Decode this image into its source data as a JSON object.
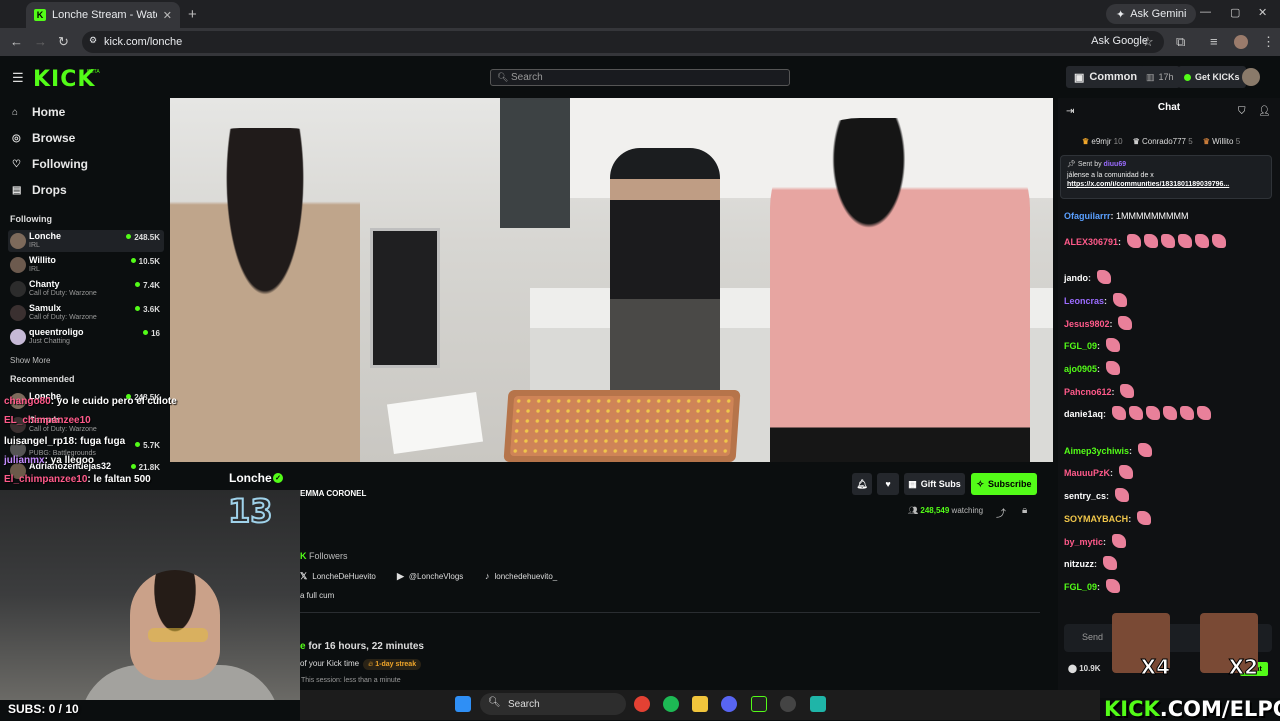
{
  "browser": {
    "tab_title": "Lonche Stream - Watch Live",
    "url": "kick.com/lonche",
    "ask_gemini": "Ask Gemini",
    "ask_google": "Ask Google"
  },
  "header": {
    "logo": "KICK",
    "beta": "BETA",
    "search_placeholder": "Search",
    "common": "Common",
    "hours": "17h",
    "get_kicks": "Get KICKs"
  },
  "sidebar": {
    "nav": [
      {
        "label": "Home",
        "icon": "home-icon"
      },
      {
        "label": "Browse",
        "icon": "compass-icon"
      },
      {
        "label": "Following",
        "icon": "heart-icon"
      },
      {
        "label": "Drops",
        "icon": "gift-icon"
      }
    ],
    "following_title": "Following",
    "following": [
      {
        "name": "Lonche",
        "category": "IRL",
        "viewers": "248.5K"
      },
      {
        "name": "Willito",
        "category": "IRL",
        "viewers": "10.5K"
      },
      {
        "name": "Chanty",
        "category": "Call of Duty: Warzone",
        "viewers": "7.4K"
      },
      {
        "name": "Samulx",
        "category": "Call of Duty: Warzone",
        "viewers": "3.6K"
      },
      {
        "name": "queentroligo",
        "category": "Just Chatting",
        "viewers": "16"
      }
    ],
    "show_more": "Show More",
    "recommended_title": "Recommended",
    "recommended": [
      {
        "name": "Lonche",
        "category": "",
        "viewers": "248.5K"
      },
      {
        "name": "Samulx",
        "category": "Call of Duty: Warzone",
        "viewers": ""
      },
      {
        "name": "",
        "category": "PUBG: Battlegrounds",
        "viewers": "5.7K"
      },
      {
        "name": "Adrianozendejas32",
        "category": "",
        "viewers": "21.8K"
      }
    ]
  },
  "channel": {
    "name": "Lonche",
    "stream_title": "EMMA CORONEL",
    "buttons": {
      "gift": "Gift Subs",
      "subscribe": "Subscribe"
    },
    "watching_count": "248,549",
    "watching_label": "watching",
    "followers_label": "Followers",
    "followers_prefix": "K",
    "socials": [
      {
        "icon": "x-icon",
        "handle": "LoncheDeHuevito"
      },
      {
        "icon": "youtube-icon",
        "handle": "@LoncheVlogs"
      },
      {
        "icon": "tiktok-icon",
        "handle": "lonchedehuevito_"
      }
    ],
    "bio": "a full cum",
    "live_for_prefix": "e",
    "live_for": "for",
    "live_duration": "16 hours, 22 minutes",
    "kick_time": "of your Kick time",
    "streak": "1-day streak",
    "session": "This session: less than a minute"
  },
  "chat": {
    "title": "Chat",
    "gifters": [
      {
        "name": "e9mjr",
        "count": "10"
      },
      {
        "name": "Conrado777",
        "count": "5"
      },
      {
        "name": "Willito",
        "count": "5"
      }
    ],
    "pinned": {
      "sent_by": "Sent by",
      "user": "diuu69",
      "text": "jálense a la comunidad de x",
      "link": "https://x.com/i/communities/1831801189039796..."
    },
    "messages": [
      {
        "user": "Ofaguilarrr",
        "color": "#5aa0ff",
        "text": "1MMMMMMMMM",
        "emotes": 0
      },
      {
        "user": "ALEX306791",
        "color": "#ff5a8a",
        "text": "",
        "emotes": 7
      },
      {
        "user": "jando",
        "color": "#ffffff",
        "text": "",
        "emotes": 1
      },
      {
        "user": "Leoncras",
        "color": "#9b6cff",
        "text": "",
        "emotes": 1
      },
      {
        "user": "Jesus9802",
        "color": "#ff5a8a",
        "text": "",
        "emotes": 1
      },
      {
        "user": "FGL_09",
        "color": "#53fc18",
        "text": "",
        "emotes": 1
      },
      {
        "user": "ajo0905",
        "color": "#53fc18",
        "text": "",
        "emotes": 1
      },
      {
        "user": "Pahcno612",
        "color": "#ff5a8a",
        "text": "",
        "emotes": 1
      },
      {
        "user": "danie1aq",
        "color": "#ffffff",
        "text": "",
        "emotes": 9
      },
      {
        "user": "Aimep3ychiwis",
        "color": "#53fc18",
        "text": "",
        "emotes": 1
      },
      {
        "user": "MauuuPzK",
        "color": "#ff5a8a",
        "text": "",
        "emotes": 1
      },
      {
        "user": "sentry_cs",
        "color": "#ffffff",
        "text": "",
        "emotes": 1
      },
      {
        "user": "SOYMAYBACH",
        "color": "#f0c64a",
        "text": "",
        "emotes": 1
      },
      {
        "user": "by_mytic",
        "color": "#ff5a8a",
        "text": "",
        "emotes": 1
      },
      {
        "user": "nitzuzz",
        "color": "#ffffff",
        "text": "",
        "emotes": 1
      },
      {
        "user": "FGL_09",
        "color": "#53fc18",
        "text": "",
        "emotes": 1
      }
    ],
    "input_placeholder": "Send",
    "count": "10.9K",
    "chat_button": "Chat"
  },
  "overlay": {
    "subs": "SUBS: 0 / 10",
    "neon": "13",
    "brand_green": "KICK",
    "brand_white": ".COM/ELPOLIN",
    "mult_left": "X4",
    "mult_right": "X2",
    "chat": [
      {
        "user": "chango80",
        "text": ": yo le cuido pero el culote"
      },
      {
        "user": "EL_chimpanzee10",
        "text": ""
      },
      {
        "user": "luisangel_rp18",
        "text": ": fuga fuga"
      },
      {
        "user": "julianmx",
        "text": ": ya llegoo"
      },
      {
        "user": "El_chimpanzee10",
        "text": ": le faltan 500"
      }
    ]
  },
  "taskbar": {
    "search": "Search"
  }
}
